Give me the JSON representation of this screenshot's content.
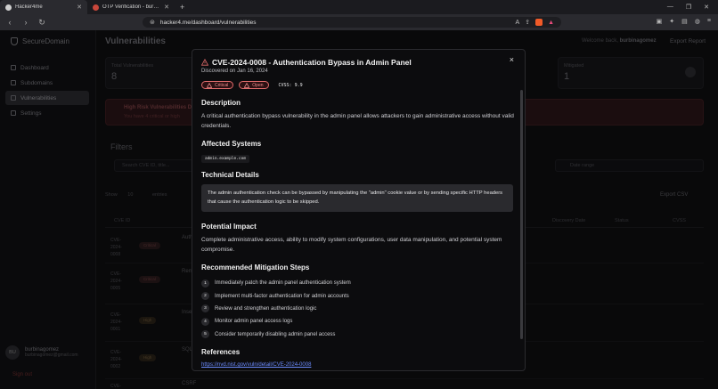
{
  "browser": {
    "tabs": [
      {
        "title": "Hacker4me",
        "active": true
      },
      {
        "title": "OTP Verification - burbinagomez@gm",
        "active": false
      }
    ],
    "new_tab": "+",
    "url": "hacker4.me/dashboard/vulnerabilities"
  },
  "sidebar": {
    "brand": "SecureDomain",
    "items": [
      {
        "label": "Dashboard"
      },
      {
        "label": "Subdomains"
      },
      {
        "label": "Vulnerabilities"
      },
      {
        "label": "Settings"
      }
    ],
    "user": {
      "initials": "BU",
      "name": "burbinagomez",
      "email": "burbinagomez@gmail.com"
    },
    "sign_out": "Sign out"
  },
  "header": {
    "title": "Vulnerabilities",
    "welcome": "Welcome back,",
    "username": "burbinagomez",
    "export_report": "Export Report"
  },
  "stats": {
    "total_label": "Total Vulnerabilities",
    "total_value": "8",
    "mitigated_label": "Mitigated",
    "mitigated_value": "1"
  },
  "alert": {
    "title": "High Risk Vulnerabilities Detected",
    "text": "You have 4 critical or high"
  },
  "filters": {
    "title": "Filters",
    "search_placeholder": "Search CVE ID, title...",
    "date_placeholder": "Date range",
    "show_label": "Show",
    "show_value": "10",
    "entries_label": "entries",
    "export_csv": "Export CSV"
  },
  "table": {
    "headers": [
      "CVE ID",
      "Discovery Date",
      "Status",
      "CVSS"
    ],
    "rows": [
      {
        "id": "CVE-2024-0008",
        "severity": "Critical",
        "title": "Auth"
      },
      {
        "id": "CVE-2024-0005",
        "severity": "Critical",
        "title": "Rem"
      },
      {
        "id": "CVE-2024-0001",
        "severity": "High",
        "title": "Insec"
      },
      {
        "id": "CVE-2024-0002",
        "severity": "High",
        "title": "SQL I"
      },
      {
        "id": "CVE-",
        "severity": "",
        "title": "CSRF"
      }
    ]
  },
  "modal": {
    "title": "CVE-2024-0008 - Authentication Bypass in Admin Panel",
    "discovered": "Discovered on Jan 16, 2024",
    "close": "×",
    "badges": {
      "severity": "Critical",
      "status": "Open",
      "cvss": "CVSS: 9.9"
    },
    "description_h": "Description",
    "description": "A critical authentication bypass vulnerability in the admin panel allows attackers to gain administrative access without valid credentials.",
    "affected_h": "Affected Systems",
    "affected": "admin.example.com",
    "technical_h": "Technical Details",
    "technical": "The admin authentication check can be bypassed by manipulating the \"admin\" cookie value or by sending specific HTTP headers that cause the authentication logic to be skipped.",
    "impact_h": "Potential Impact",
    "impact": "Complete administrative access, ability to modify system configurations, user data manipulation, and potential system compromise.",
    "mitigation_h": "Recommended Mitigation Steps",
    "steps": [
      {
        "n": "1",
        "text": "Immediately patch the admin panel authentication system"
      },
      {
        "n": "2",
        "text": "Implement multi-factor authentication for admin accounts"
      },
      {
        "n": "3",
        "text": "Review and strengthen authentication logic"
      },
      {
        "n": "4",
        "text": "Monitor admin panel access logs"
      },
      {
        "n": "5",
        "text": "Consider temporarily disabling admin panel access"
      }
    ],
    "references_h": "References",
    "reference_link": "https://nvd.nist.gov/vuln/detail/CVE-2024-0008"
  },
  "colors": {
    "critical": "#e06b6b",
    "link": "#6c8cff",
    "panel": "#0c0c0e"
  }
}
